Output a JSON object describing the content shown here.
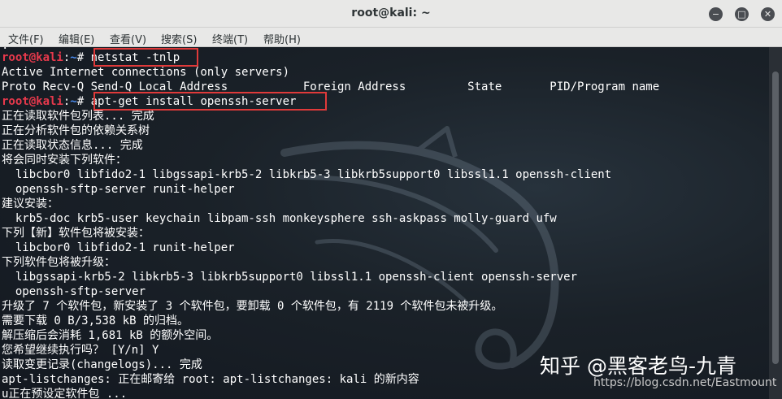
{
  "window": {
    "title": "root@kali: ~",
    "minimize_icon": "−",
    "maximize_icon": "□",
    "close_icon": "✕"
  },
  "menubar": {
    "items": [
      "文件(F)",
      "编辑(E)",
      "查看(V)",
      "搜索(S)",
      "终端(T)",
      "帮助(H)"
    ]
  },
  "terminal": {
    "prompt_user": "root@kali",
    "prompt_sep": ":",
    "prompt_path": "~",
    "prompt_symbol": "# ",
    "cmd1": "netstat -tnlp",
    "cmd2": "apt-get install openssh-server",
    "lines": [
      "Active Internet connections (only servers)",
      "Proto Recv-Q Send-Q Local Address           Foreign Address         State       PID/Program name",
      "正在读取软件包列表... 完成",
      "正在分析软件包的依赖关系树",
      "正在读取状态信息... 完成",
      "将会同时安装下列软件：",
      "  libcbor0 libfido2-1 libgssapi-krb5-2 libkrb5-3 libkrb5support0 libssl1.1 openssh-client",
      "  openssh-sftp-server runit-helper",
      "建议安装：",
      "  krb5-doc krb5-user keychain libpam-ssh monkeysphere ssh-askpass molly-guard ufw",
      "下列【新】软件包将被安装：",
      "  libcbor0 libfido2-1 runit-helper",
      "下列软件包将被升级：",
      "  libgssapi-krb5-2 libkrb5-3 libkrb5support0 libssl1.1 openssh-client openssh-server",
      "  openssh-sftp-server",
      "升级了 7 个软件包，新安装了 3 个软件包，要卸载 0 个软件包，有 2119 个软件包未被升级。",
      "需要下载 0 B/3,538 kB 的归档。",
      "解压缩后会消耗 1,681 kB 的额外空间。",
      "您希望继续执行吗？ [Y/n] Y",
      "读取变更记录(changelogs)... 完成",
      "apt-listchanges: 正在邮寄给 root: apt-listchanges: kali 的新内容",
      "u正在预设定软件包 ..."
    ]
  },
  "watermark": {
    "text": "知乎 @黑客老鸟-九青",
    "url": "https://blog.csdn.net/Eastmount"
  },
  "colors": {
    "prompt_user": "#e8394c",
    "prompt_path": "#4a8cf0",
    "highlight_box": "#e03a3a",
    "terminal_bg": "#151a1f"
  }
}
